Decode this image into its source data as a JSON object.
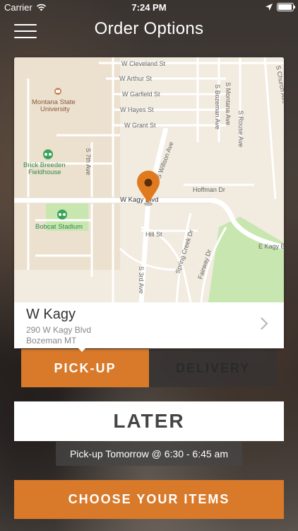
{
  "status_bar": {
    "carrier": "Carrier",
    "time": "7:24 PM",
    "icons": [
      "wifi-icon",
      "location-arrow-icon",
      "battery-icon"
    ]
  },
  "nav": {
    "title": "Order Options",
    "menu_icon": "hamburger-menu-icon"
  },
  "map": {
    "streets": [
      "W Cleveland St",
      "W Arthur St",
      "W Garfield St",
      "W Hayes St",
      "W Grant St",
      "W Kagy Blvd",
      "Hoffman Dr",
      "E Kagy B",
      "Hill St",
      "S Willson Ave",
      "S Church Ave",
      "S Bozeman Ave",
      "S Montana Ave",
      "S Rouse Ave",
      "S 7th Ave",
      "S 3rd Ave",
      "Spring Creek Dr",
      "Fairway Dr"
    ],
    "places": [
      "Montana State University",
      "Brick Breeden Fieldhouse",
      "Bobcat Stadium"
    ],
    "pin_color": "#e07a1f"
  },
  "store": {
    "name": "W Kagy",
    "address_line1": "290 W Kagy Blvd",
    "address_line2": "Bozeman MT"
  },
  "mode": {
    "pickup_label": "PICK-UP",
    "delivery_label": "DELIVERY",
    "selected": "PICK-UP"
  },
  "schedule": {
    "later_label": "LATER",
    "pickup_time": "Pick-up Tomorrow @ 6:30 - 6:45 am"
  },
  "cta": {
    "choose_label": "CHOOSE YOUR ITEMS"
  },
  "colors": {
    "accent": "#d97a2b",
    "map_bg": "#f1ebe0",
    "park": "#c8e6b0"
  }
}
